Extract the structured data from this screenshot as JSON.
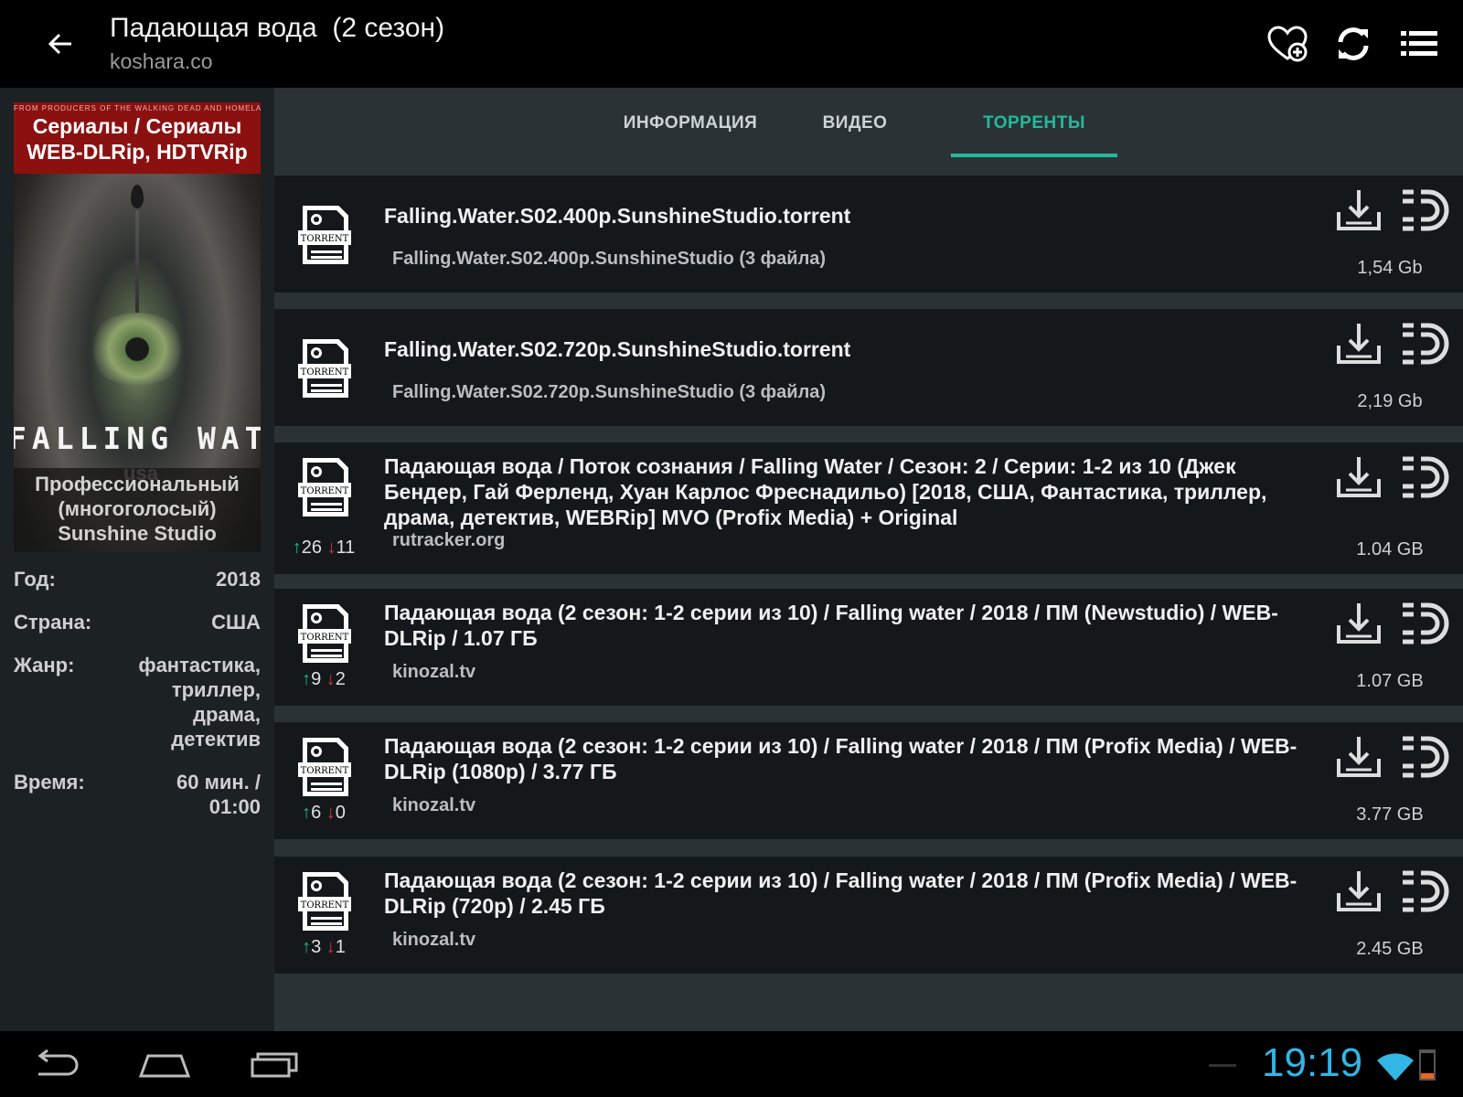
{
  "header": {
    "title": "Падающая вода  (2 сезон)",
    "subtitle": "koshara.co",
    "icons": [
      "back-arrow-icon",
      "favorite-heart-add-icon",
      "refresh-icon",
      "menu-list-icon"
    ]
  },
  "sidebar": {
    "poster": {
      "top_line": "FROM PRODUCERS OF THE WALKING DEAD AND HOMELAND",
      "category_line1": "Сериалы / Сериалы",
      "category_line2": "WEB-DLRip, HDTVRip",
      "show_name": "FALLING WATER",
      "network": "usa",
      "voice_line1": "Профессиональный",
      "voice_line2": "(многоголосый)",
      "voice_line3": "Sunshine Studio"
    },
    "info": [
      {
        "label": "Год:",
        "value": "2018"
      },
      {
        "label": "Страна:",
        "value": "США"
      },
      {
        "label": "Жанр:",
        "value": "фантастика, триллер, драма, детектив"
      },
      {
        "label": "Время:",
        "value": "60 мин. / 01:00"
      }
    ]
  },
  "tabs": [
    {
      "label": "ИНФОРМАЦИЯ",
      "active": false
    },
    {
      "label": "ВИДЕО",
      "active": false
    },
    {
      "label": "ТОРРЕНТЫ",
      "active": true
    }
  ],
  "torrents": [
    {
      "title": "Falling.Water.S02.400p.SunshineStudio.torrent",
      "subtitle": "Falling.Water.S02.400p.SunshineStudio (3 файла)",
      "size": "1,54 Gb",
      "seeds": "",
      "peers": ""
    },
    {
      "title": "Falling.Water.S02.720p.SunshineStudio.torrent",
      "subtitle": "Falling.Water.S02.720p.SunshineStudio (3 файла)",
      "size": "2,19 Gb",
      "seeds": "",
      "peers": ""
    },
    {
      "title": "Падающая вода / Поток сознания / Falling Water / Сезон: 2 / Серии: 1-2 из 10 (Джек Бендер, Гай Ферленд, Хуан Карлос Фреснадильо) [2018, США, Фантастика, триллер, драма, детектив, WEBRip] MVO (Profix Media) + Original",
      "subtitle": "rutracker.org",
      "size": "1.04 GB",
      "seeds": "26",
      "peers": "11"
    },
    {
      "title": "Падающая вода (2 сезон: 1-2 серии из 10) / Falling water / 2018 / ПМ (Newstudio) / WEB-DLRip / 1.07 ГБ",
      "subtitle": "kinozal.tv",
      "size": "1.07 GB",
      "seeds": "9",
      "peers": "2"
    },
    {
      "title": "Падающая вода (2 сезон: 1-2 серии из 10) / Falling water / 2018 / ПМ (Profix Media) / WEB-DLRip (1080p) / 3.77 ГБ",
      "subtitle": "kinozal.tv",
      "size": "3.77 GB",
      "seeds": "6",
      "peers": "0"
    },
    {
      "title": "Падающая вода (2 сезон: 1-2 серии из 10) / Falling water / 2018 / ПМ (Profix Media) / WEB-DLRip (720p) / 2.45 ГБ",
      "subtitle": "kinozal.tv",
      "size": "2.45 GB",
      "seeds": "3",
      "peers": "1"
    }
  ],
  "torrent_icon_label": "TORRENT",
  "statusbar": {
    "clock": "19:19",
    "icons": [
      "nav-back-icon",
      "nav-home-icon",
      "nav-recents-icon",
      "wifi-icon",
      "battery-icon"
    ]
  },
  "colors": {
    "accent": "#25b99b",
    "seed_up": "#27b57b",
    "peer_down": "#d8372b",
    "clock": "#33b5e5"
  }
}
